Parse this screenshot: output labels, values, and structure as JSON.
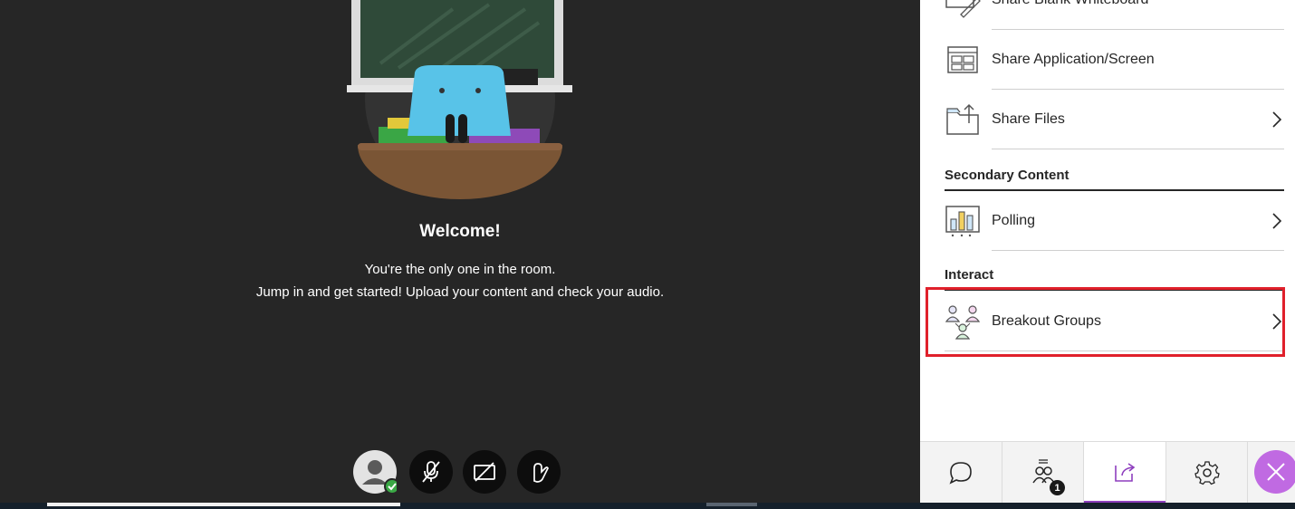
{
  "welcome": {
    "title": "Welcome!",
    "line1": "You're the only one in the room.",
    "line2": "Jump in and get started! Upload your content and check your audio."
  },
  "controls": [
    {
      "name": "my-status",
      "icon": "avatar-icon"
    },
    {
      "name": "microphone",
      "icon": "microphone-muted-icon"
    },
    {
      "name": "camera",
      "icon": "camera-off-icon"
    },
    {
      "name": "raise-hand",
      "icon": "raise-hand-icon"
    }
  ],
  "panel": {
    "primary_items": [
      {
        "label": "Share Blank Whiteboard",
        "icon": "whiteboard-icon",
        "has_chevron": false
      },
      {
        "label": "Share Application/Screen",
        "icon": "screen-share-icon",
        "has_chevron": false
      },
      {
        "label": "Share Files",
        "icon": "folder-share-icon",
        "has_chevron": true
      }
    ],
    "secondary": {
      "title": "Secondary Content",
      "items": [
        {
          "label": "Polling",
          "icon": "poll-chart-icon",
          "has_chevron": true
        }
      ]
    },
    "interact": {
      "title": "Interact",
      "items": [
        {
          "label": "Breakout Groups",
          "icon": "breakout-groups-icon",
          "has_chevron": true
        }
      ]
    },
    "nav": [
      {
        "name": "chat",
        "icon": "chat-icon"
      },
      {
        "name": "attendees",
        "icon": "attendees-icon",
        "badge": "1"
      },
      {
        "name": "share-content",
        "icon": "share-content-icon",
        "active": true
      },
      {
        "name": "settings",
        "icon": "gear-icon"
      }
    ]
  },
  "colors": {
    "accent": "#8e3fbe",
    "highlight": "#e0202b",
    "stage": "#262626",
    "close": "#c06ae2"
  }
}
